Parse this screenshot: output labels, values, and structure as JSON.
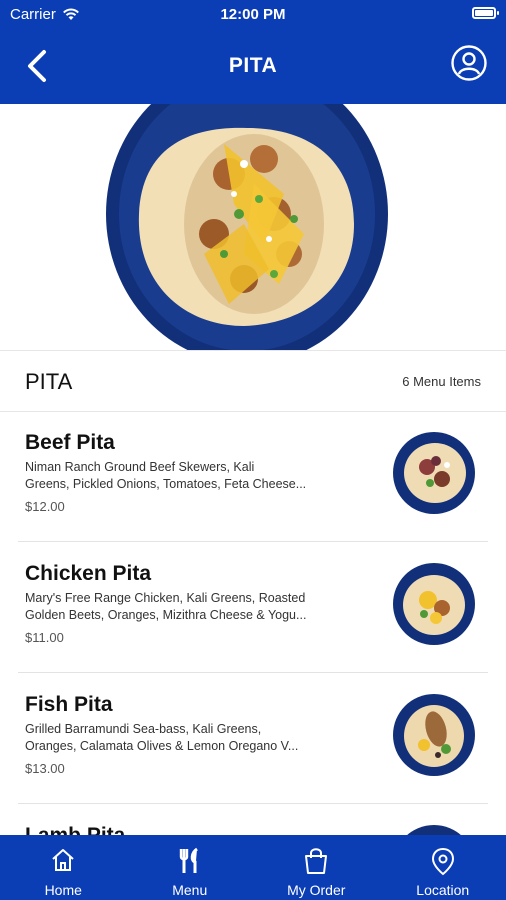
{
  "status": {
    "carrier": "Carrier",
    "time": "12:00 PM"
  },
  "header": {
    "title": "PITA"
  },
  "section": {
    "name": "PITA",
    "count": "6 Menu Items"
  },
  "items": [
    {
      "name": "Beef Pita",
      "desc1": "Niman Ranch Ground  Beef Skewers, Kali",
      "desc2": "Greens, Pickled Onions, Tomatoes, Feta Cheese...",
      "price": "$12.00"
    },
    {
      "name": "Chicken Pita",
      "desc1": "Mary's Free Range Chicken, Kali Greens, Roasted",
      "desc2": "Golden Beets, Oranges, Mizithra Cheese & Yogu...",
      "price": "$11.00"
    },
    {
      "name": "Fish Pita",
      "desc1": "Grilled Barramundi Sea-bass, Kali Greens,",
      "desc2": "Oranges, Calamata  Olives & Lemon Oregano V...",
      "price": "$13.00"
    },
    {
      "name": "Lamb Pita",
      "desc1": "",
      "desc2": "",
      "price": ""
    }
  ],
  "tabs": [
    {
      "label": "Home",
      "icon": "home-icon"
    },
    {
      "label": "Menu",
      "icon": "fork-knife-icon"
    },
    {
      "label": "My Order",
      "icon": "shopping-bag-icon"
    },
    {
      "label": "Location",
      "icon": "location-pin-icon"
    }
  ],
  "colors": {
    "brand": "#0b3db5",
    "plate": "#12307a"
  }
}
